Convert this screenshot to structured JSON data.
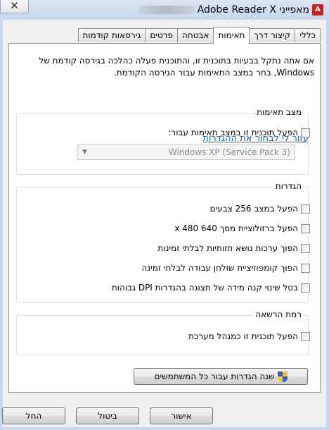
{
  "window": {
    "title": "Adobe Reader X מאפייני",
    "close_glyph": "✕",
    "app_icon_letter": "A"
  },
  "tabs": [
    {
      "label": "כללי"
    },
    {
      "label": "קיצור דרך"
    },
    {
      "label": "תאימות"
    },
    {
      "label": "אבטחה"
    },
    {
      "label": "פרטים"
    },
    {
      "label": "גירסאות קודמות"
    }
  ],
  "active_tab": "תאימות",
  "intro_text": "אם אתה נתקל בבעיות בתוכנית זו, והתוכנית פעלה כהלכה בגירסה קודמת של Windows, בחר במצב התאימות עבור הגירסה הקודמת.",
  "help_link": "עזור לי לבחור את ההגדרות",
  "compat_mode": {
    "legend": "מצב תאימות",
    "checkbox_label": "הפעל תוכנית זו במצב תאימות עבור:",
    "checked": false,
    "select_value": "Windows XP (Service Pack 3)",
    "select_enabled": false
  },
  "settings": {
    "legend": "הגדרות",
    "items": [
      {
        "label": "הפעל במצב 256 צבעים",
        "checked": false
      },
      {
        "label": "הפעל ברזולוציית מסך 640 x 480",
        "checked": false
      },
      {
        "label": "הפוך ערכות נושא חזותיות לבלתי זמינות",
        "checked": false
      },
      {
        "label": "הפוך קומפוזיציית שולחן עבודה לבלתי זמינה",
        "checked": false
      },
      {
        "label": "בטל שינוי קנה מידה של תצוגה בהגדרות DPI גבוהות",
        "checked": false
      }
    ]
  },
  "privilege": {
    "legend": "רמת הרשאה",
    "checkbox_label": "הפעל תוכנית זו כמנהל מערכת",
    "checked": false
  },
  "all_users_button": "שנה הגדרות עבור כל המשתמשים",
  "footer": {
    "ok": "אישור",
    "cancel": "ביטול",
    "apply": "החל"
  }
}
